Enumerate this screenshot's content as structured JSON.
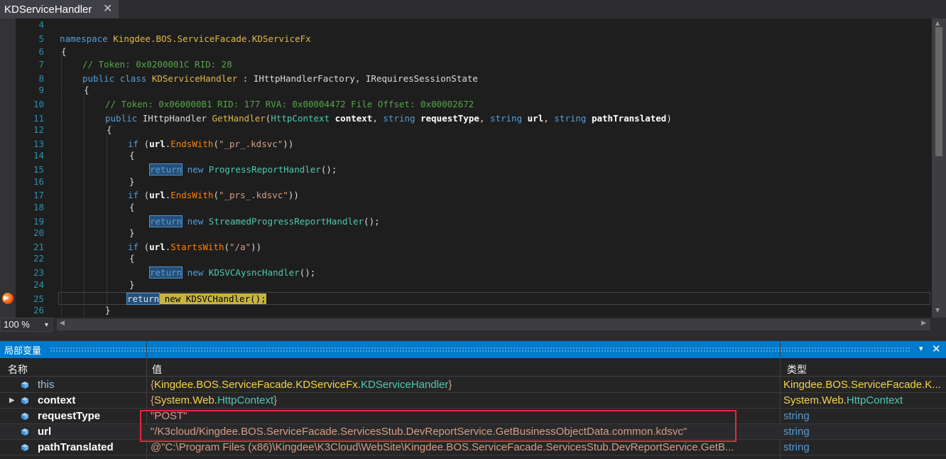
{
  "tab": {
    "title": "KDServiceHandler",
    "close": "✕"
  },
  "editor": {
    "line_numbers": [
      "4",
      "5",
      "6",
      "7",
      "8",
      "9",
      "10",
      "11",
      "12",
      "13",
      "14",
      "15",
      "16",
      "17",
      "18",
      "19",
      "20",
      "21",
      "22",
      "23",
      "24",
      "25",
      "26"
    ],
    "ns_kw": "namespace",
    "ns_name": "Kingdee.BOS.ServiceFacade.KDServiceFx",
    "brace_open": "{",
    "brace_close": "}",
    "comment1": "// Token: 0x0200001C RID: 28",
    "public_kw": "public",
    "class_kw": "class",
    "class_name": "KDServiceHandler",
    "class_rest": " : IHttpHandlerFactory, IRequiresSessionState",
    "comment2": "// Token: 0x060000B1 RID: 177 RVA: 0x00004472 File Offset: 0x00002672",
    "ret_type": "IHttpHandler",
    "method_name": "GetHandler",
    "param_type1": "HttpContext",
    "param1": "context",
    "string_kw": "string",
    "param2": "requestType",
    "param3": "url",
    "param4": "pathTranslated",
    "if_kw": "if",
    "url": "url",
    "ends_with": "EndsWith",
    "starts_with": "StartsWith",
    "str1": "\"_pr_.kdsvc\"",
    "str2": "\"_prs_.kdsvc\"",
    "str3": "\"/a\"",
    "return_kw": "return",
    "new_kw": "new",
    "handler1": "ProgressReportHandler",
    "handler2": "StreamedProgressReportHandler",
    "handler3": "KDSVCAysncHandler",
    "handler4": "KDSVCHandler"
  },
  "zoom": {
    "value": "100 %"
  },
  "locals": {
    "title": "局部变量",
    "dropdown": "▾",
    "close": "✕",
    "columns": {
      "name": "名称",
      "value": "值",
      "type": "类型"
    },
    "rows": [
      {
        "name": "this",
        "value_ns": "Kingdee.BOS.ServiceFacade.KDServiceFx.",
        "value_ty": "KDServiceHandler",
        "type_ns": "Kingdee.BOS.ServiceFacade.K..."
      },
      {
        "name": "context",
        "value_ns": "System.Web.",
        "value_ty": "HttpContext",
        "type_ns": "System.Web.",
        "type_ty": "HttpContext"
      },
      {
        "name": "requestType",
        "value": "\"POST\"",
        "type": "string"
      },
      {
        "name": "url",
        "value": "\"/K3cloud/Kingdee.BOS.ServiceFacade.ServicesStub.DevReportService.GetBusinessObjectData.common.kdsvc\"",
        "type": "string"
      },
      {
        "name": "pathTranslated",
        "value": "@\"C:\\Program Files (x86)\\Kingdee\\K3Cloud\\WebSite\\Kingdee.BOS.ServiceFacade.ServicesStub.DevReportService.GetB...",
        "type": "string"
      }
    ],
    "brace_open": "{",
    "brace_close": "}"
  }
}
